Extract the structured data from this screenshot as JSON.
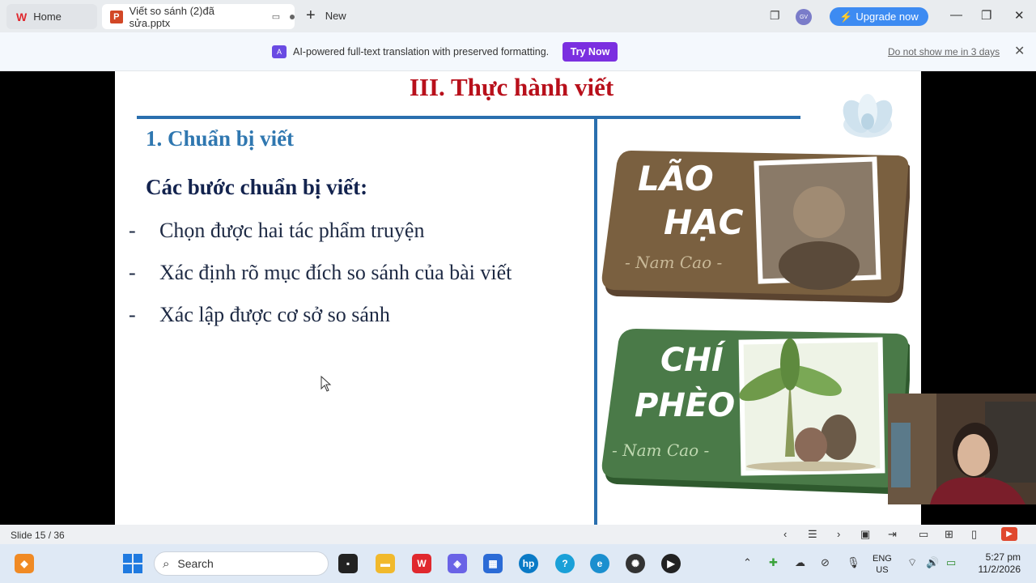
{
  "titlebar": {
    "home_tab": "Home",
    "doc_tab": "Viết so sánh (2)đã sửa.pptx",
    "new_tab": "New",
    "avatar_initials": "GV",
    "upgrade_label": "Upgrade now"
  },
  "banner": {
    "icon_label": "A",
    "message": "AI-powered full-text translation with preserved formatting.",
    "try_label": "Try Now",
    "dont_show": "Do not show me in 3 days"
  },
  "slide": {
    "title": "III. Thực hành viết",
    "subtitle": "1. Chuẩn bị viết",
    "steps_title": "Các bước chuẩn bị viết:",
    "bullets": [
      "Chọn được hai tác phẩm truyện",
      "Xác định rõ mục đích so sánh của bài viết",
      "Xác lập được cơ sở so sánh"
    ],
    "card1": {
      "title_line1": "LÃO",
      "title_line2": "HẠC",
      "author": "- Nam Cao -",
      "color": "#7a6040"
    },
    "card2": {
      "title_line1": "CHÍ",
      "title_line2": "PHÈO",
      "author": "- Nam Cao -",
      "color": "#4a7a48"
    }
  },
  "statusbar": {
    "slide_indicator": "Slide 15 / 36"
  },
  "taskbar": {
    "search_placeholder": "Search",
    "lang_line1": "ENG",
    "lang_line2": "US",
    "time": "5:27 pm",
    "date": "11/2/2026"
  },
  "colors": {
    "accent": "#2a6fae",
    "title_red": "#b8101b",
    "upgrade_blue": "#3d8bf2",
    "try_purple": "#7b2fe0"
  }
}
